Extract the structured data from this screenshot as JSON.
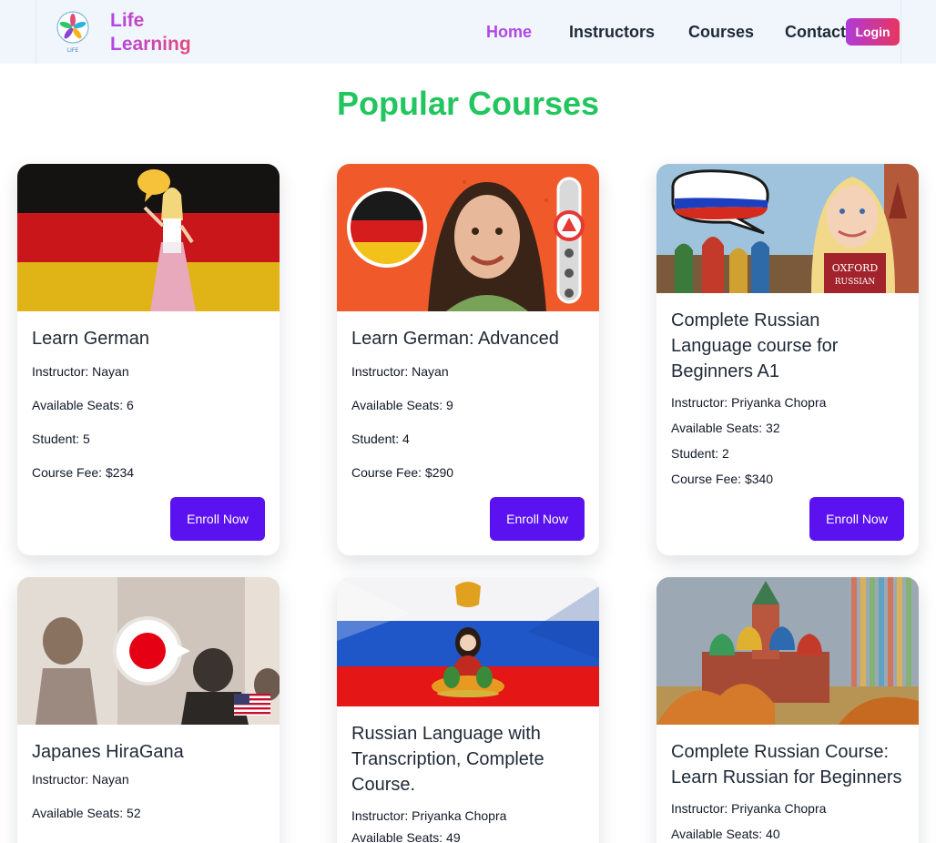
{
  "nav": {
    "brand_line1": "Life",
    "brand_line2": "Learning",
    "logo_text": "LIFE",
    "links": [
      "Home",
      "Instructors",
      "Courses",
      "Contact"
    ],
    "login_label": "Login"
  },
  "section_title": "Popular Courses",
  "labels": {
    "instructor": "Instructor:",
    "seats": "Available Seats:",
    "students": "Student:",
    "fee": "Course Fee:",
    "enroll": "Enroll Now"
  },
  "courses": [
    {
      "title": "Learn German",
      "instructor": "Nayan",
      "seats": "6",
      "students": "5",
      "fee": "$234",
      "image_icon": "germany-flag-woman-photo"
    },
    {
      "title": "Learn German: Advanced",
      "instructor": "Nayan",
      "seats": "9",
      "students": "4",
      "fee": "$290",
      "image_icon": "german-teacher-photo"
    },
    {
      "title": "Complete Russian Language course for Beginners A1",
      "instructor": "Priyanka Chopra",
      "seats": "32",
      "students": "2",
      "fee": "$340",
      "image_icon": "russia-flag-kremlin-photo"
    },
    {
      "title": "Japanes HiraGana",
      "instructor": "Nayan",
      "seats": "52",
      "image_icon": "japan-flag-classroom-photo"
    },
    {
      "title": "Russian Language with Transcription, Complete Course.",
      "instructor": "Priyanka Chopra",
      "seats": "49",
      "image_icon": "russia-flag-matryoshka-photo"
    },
    {
      "title": "Complete Russian Course: Learn Russian for Beginners",
      "instructor": "Priyanka Chopra",
      "seats": "40",
      "image_icon": "moscow-cathedral-photo"
    }
  ],
  "colors": {
    "accent": "#b047e8",
    "title_green": "#22c55e",
    "button": "#5b12f0"
  }
}
